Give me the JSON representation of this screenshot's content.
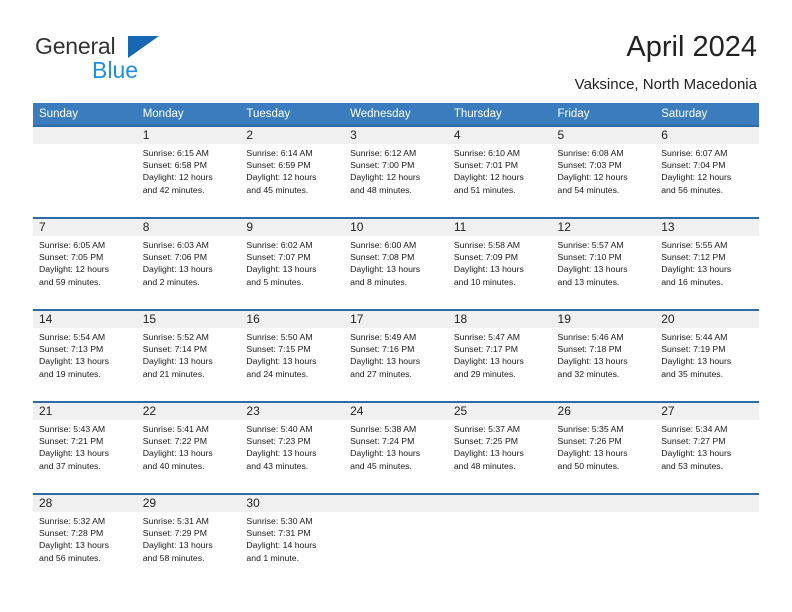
{
  "brand": {
    "name_part1": "General",
    "name_part2": "Blue",
    "triangle_color": "#1668b3"
  },
  "header": {
    "title": "April 2024",
    "subtitle": "Vaksince, North Macedonia"
  },
  "theme": {
    "header_bg": "#3a7cbe",
    "row_divider": "#2c6aa8",
    "day_number_bg": "#f0f0f0"
  },
  "weekday_headers": [
    "Sunday",
    "Monday",
    "Tuesday",
    "Wednesday",
    "Thursday",
    "Friday",
    "Saturday"
  ],
  "weeks": [
    [
      {
        "day": "",
        "empty": true,
        "sunrise": "",
        "sunset": "",
        "daylight_line1": "",
        "daylight_line2": ""
      },
      {
        "day": "1",
        "empty": false,
        "sunrise": "Sunrise: 6:15 AM",
        "sunset": "Sunset: 6:58 PM",
        "daylight_line1": "Daylight: 12 hours",
        "daylight_line2": "and 42 minutes."
      },
      {
        "day": "2",
        "empty": false,
        "sunrise": "Sunrise: 6:14 AM",
        "sunset": "Sunset: 6:59 PM",
        "daylight_line1": "Daylight: 12 hours",
        "daylight_line2": "and 45 minutes."
      },
      {
        "day": "3",
        "empty": false,
        "sunrise": "Sunrise: 6:12 AM",
        "sunset": "Sunset: 7:00 PM",
        "daylight_line1": "Daylight: 12 hours",
        "daylight_line2": "and 48 minutes."
      },
      {
        "day": "4",
        "empty": false,
        "sunrise": "Sunrise: 6:10 AM",
        "sunset": "Sunset: 7:01 PM",
        "daylight_line1": "Daylight: 12 hours",
        "daylight_line2": "and 51 minutes."
      },
      {
        "day": "5",
        "empty": false,
        "sunrise": "Sunrise: 6:08 AM",
        "sunset": "Sunset: 7:03 PM",
        "daylight_line1": "Daylight: 12 hours",
        "daylight_line2": "and 54 minutes."
      },
      {
        "day": "6",
        "empty": false,
        "sunrise": "Sunrise: 6:07 AM",
        "sunset": "Sunset: 7:04 PM",
        "daylight_line1": "Daylight: 12 hours",
        "daylight_line2": "and 56 minutes."
      }
    ],
    [
      {
        "day": "7",
        "empty": false,
        "sunrise": "Sunrise: 6:05 AM",
        "sunset": "Sunset: 7:05 PM",
        "daylight_line1": "Daylight: 12 hours",
        "daylight_line2": "and 59 minutes."
      },
      {
        "day": "8",
        "empty": false,
        "sunrise": "Sunrise: 6:03 AM",
        "sunset": "Sunset: 7:06 PM",
        "daylight_line1": "Daylight: 13 hours",
        "daylight_line2": "and 2 minutes."
      },
      {
        "day": "9",
        "empty": false,
        "sunrise": "Sunrise: 6:02 AM",
        "sunset": "Sunset: 7:07 PM",
        "daylight_line1": "Daylight: 13 hours",
        "daylight_line2": "and 5 minutes."
      },
      {
        "day": "10",
        "empty": false,
        "sunrise": "Sunrise: 6:00 AM",
        "sunset": "Sunset: 7:08 PM",
        "daylight_line1": "Daylight: 13 hours",
        "daylight_line2": "and 8 minutes."
      },
      {
        "day": "11",
        "empty": false,
        "sunrise": "Sunrise: 5:58 AM",
        "sunset": "Sunset: 7:09 PM",
        "daylight_line1": "Daylight: 13 hours",
        "daylight_line2": "and 10 minutes."
      },
      {
        "day": "12",
        "empty": false,
        "sunrise": "Sunrise: 5:57 AM",
        "sunset": "Sunset: 7:10 PM",
        "daylight_line1": "Daylight: 13 hours",
        "daylight_line2": "and 13 minutes."
      },
      {
        "day": "13",
        "empty": false,
        "sunrise": "Sunrise: 5:55 AM",
        "sunset": "Sunset: 7:12 PM",
        "daylight_line1": "Daylight: 13 hours",
        "daylight_line2": "and 16 minutes."
      }
    ],
    [
      {
        "day": "14",
        "empty": false,
        "sunrise": "Sunrise: 5:54 AM",
        "sunset": "Sunset: 7:13 PM",
        "daylight_line1": "Daylight: 13 hours",
        "daylight_line2": "and 19 minutes."
      },
      {
        "day": "15",
        "empty": false,
        "sunrise": "Sunrise: 5:52 AM",
        "sunset": "Sunset: 7:14 PM",
        "daylight_line1": "Daylight: 13 hours",
        "daylight_line2": "and 21 minutes."
      },
      {
        "day": "16",
        "empty": false,
        "sunrise": "Sunrise: 5:50 AM",
        "sunset": "Sunset: 7:15 PM",
        "daylight_line1": "Daylight: 13 hours",
        "daylight_line2": "and 24 minutes."
      },
      {
        "day": "17",
        "empty": false,
        "sunrise": "Sunrise: 5:49 AM",
        "sunset": "Sunset: 7:16 PM",
        "daylight_line1": "Daylight: 13 hours",
        "daylight_line2": "and 27 minutes."
      },
      {
        "day": "18",
        "empty": false,
        "sunrise": "Sunrise: 5:47 AM",
        "sunset": "Sunset: 7:17 PM",
        "daylight_line1": "Daylight: 13 hours",
        "daylight_line2": "and 29 minutes."
      },
      {
        "day": "19",
        "empty": false,
        "sunrise": "Sunrise: 5:46 AM",
        "sunset": "Sunset: 7:18 PM",
        "daylight_line1": "Daylight: 13 hours",
        "daylight_line2": "and 32 minutes."
      },
      {
        "day": "20",
        "empty": false,
        "sunrise": "Sunrise: 5:44 AM",
        "sunset": "Sunset: 7:19 PM",
        "daylight_line1": "Daylight: 13 hours",
        "daylight_line2": "and 35 minutes."
      }
    ],
    [
      {
        "day": "21",
        "empty": false,
        "sunrise": "Sunrise: 5:43 AM",
        "sunset": "Sunset: 7:21 PM",
        "daylight_line1": "Daylight: 13 hours",
        "daylight_line2": "and 37 minutes."
      },
      {
        "day": "22",
        "empty": false,
        "sunrise": "Sunrise: 5:41 AM",
        "sunset": "Sunset: 7:22 PM",
        "daylight_line1": "Daylight: 13 hours",
        "daylight_line2": "and 40 minutes."
      },
      {
        "day": "23",
        "empty": false,
        "sunrise": "Sunrise: 5:40 AM",
        "sunset": "Sunset: 7:23 PM",
        "daylight_line1": "Daylight: 13 hours",
        "daylight_line2": "and 43 minutes."
      },
      {
        "day": "24",
        "empty": false,
        "sunrise": "Sunrise: 5:38 AM",
        "sunset": "Sunset: 7:24 PM",
        "daylight_line1": "Daylight: 13 hours",
        "daylight_line2": "and 45 minutes."
      },
      {
        "day": "25",
        "empty": false,
        "sunrise": "Sunrise: 5:37 AM",
        "sunset": "Sunset: 7:25 PM",
        "daylight_line1": "Daylight: 13 hours",
        "daylight_line2": "and 48 minutes."
      },
      {
        "day": "26",
        "empty": false,
        "sunrise": "Sunrise: 5:35 AM",
        "sunset": "Sunset: 7:26 PM",
        "daylight_line1": "Daylight: 13 hours",
        "daylight_line2": "and 50 minutes."
      },
      {
        "day": "27",
        "empty": false,
        "sunrise": "Sunrise: 5:34 AM",
        "sunset": "Sunset: 7:27 PM",
        "daylight_line1": "Daylight: 13 hours",
        "daylight_line2": "and 53 minutes."
      }
    ],
    [
      {
        "day": "28",
        "empty": false,
        "sunrise": "Sunrise: 5:32 AM",
        "sunset": "Sunset: 7:28 PM",
        "daylight_line1": "Daylight: 13 hours",
        "daylight_line2": "and 56 minutes."
      },
      {
        "day": "29",
        "empty": false,
        "sunrise": "Sunrise: 5:31 AM",
        "sunset": "Sunset: 7:29 PM",
        "daylight_line1": "Daylight: 13 hours",
        "daylight_line2": "and 58 minutes."
      },
      {
        "day": "30",
        "empty": false,
        "sunrise": "Sunrise: 5:30 AM",
        "sunset": "Sunset: 7:31 PM",
        "daylight_line1": "Daylight: 14 hours",
        "daylight_line2": "and 1 minute."
      },
      {
        "day": "",
        "empty": true,
        "sunrise": "",
        "sunset": "",
        "daylight_line1": "",
        "daylight_line2": ""
      },
      {
        "day": "",
        "empty": true,
        "sunrise": "",
        "sunset": "",
        "daylight_line1": "",
        "daylight_line2": ""
      },
      {
        "day": "",
        "empty": true,
        "sunrise": "",
        "sunset": "",
        "daylight_line1": "",
        "daylight_line2": ""
      },
      {
        "day": "",
        "empty": true,
        "sunrise": "",
        "sunset": "",
        "daylight_line1": "",
        "daylight_line2": ""
      }
    ]
  ]
}
